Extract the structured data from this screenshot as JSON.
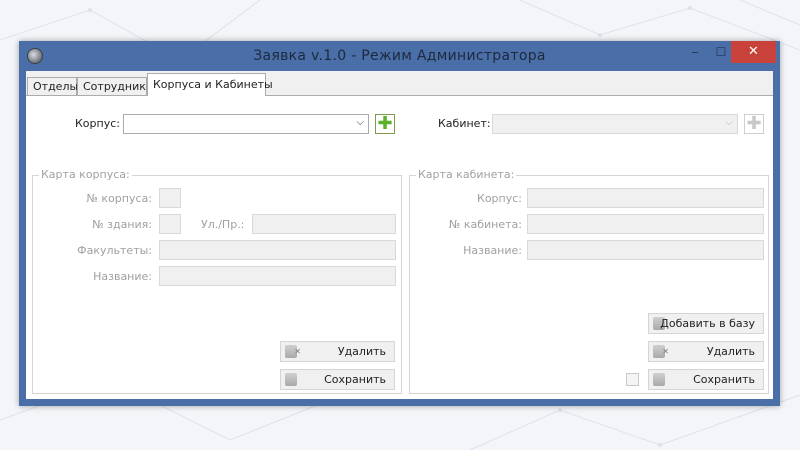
{
  "window": {
    "title": "Заявка v.1.0 - Режим Администратора",
    "controls": {
      "minimize": "‒",
      "maximize": "☐",
      "close": "✕"
    }
  },
  "tabs": [
    {
      "label": "Отделы",
      "active": false
    },
    {
      "label": "Сотрудники",
      "active": false
    },
    {
      "label": "Корпуса и Кабинеты",
      "active": true
    }
  ],
  "top_bar": {
    "building_label": "Корпус:",
    "building_value": "",
    "room_label": "Кабинет:",
    "room_value": ""
  },
  "building_card": {
    "title": "Карта корпуса:",
    "fields": {
      "number_label": "№ корпуса:",
      "building_no_label": "№ здания:",
      "street_label": "Ул./Пр.:",
      "faculties_label": "Факультеты:",
      "name_label": "Название:"
    },
    "buttons": {
      "delete": "Удалить",
      "save": "Сохранить"
    }
  },
  "room_card": {
    "title": "Карта кабинета:",
    "fields": {
      "building_label": "Корпус:",
      "room_no_label": "№ кабинета:",
      "name_label": "Название:"
    },
    "buttons": {
      "add": "Добавить в базу",
      "delete": "Удалить",
      "save": "Сохранить"
    },
    "checkbox_checked": false
  },
  "colors": {
    "titlebar": "#4a6ea8",
    "close_button": "#c8413b",
    "plus_green": "#5db12b",
    "disabled_text": "#a0a0a0"
  }
}
